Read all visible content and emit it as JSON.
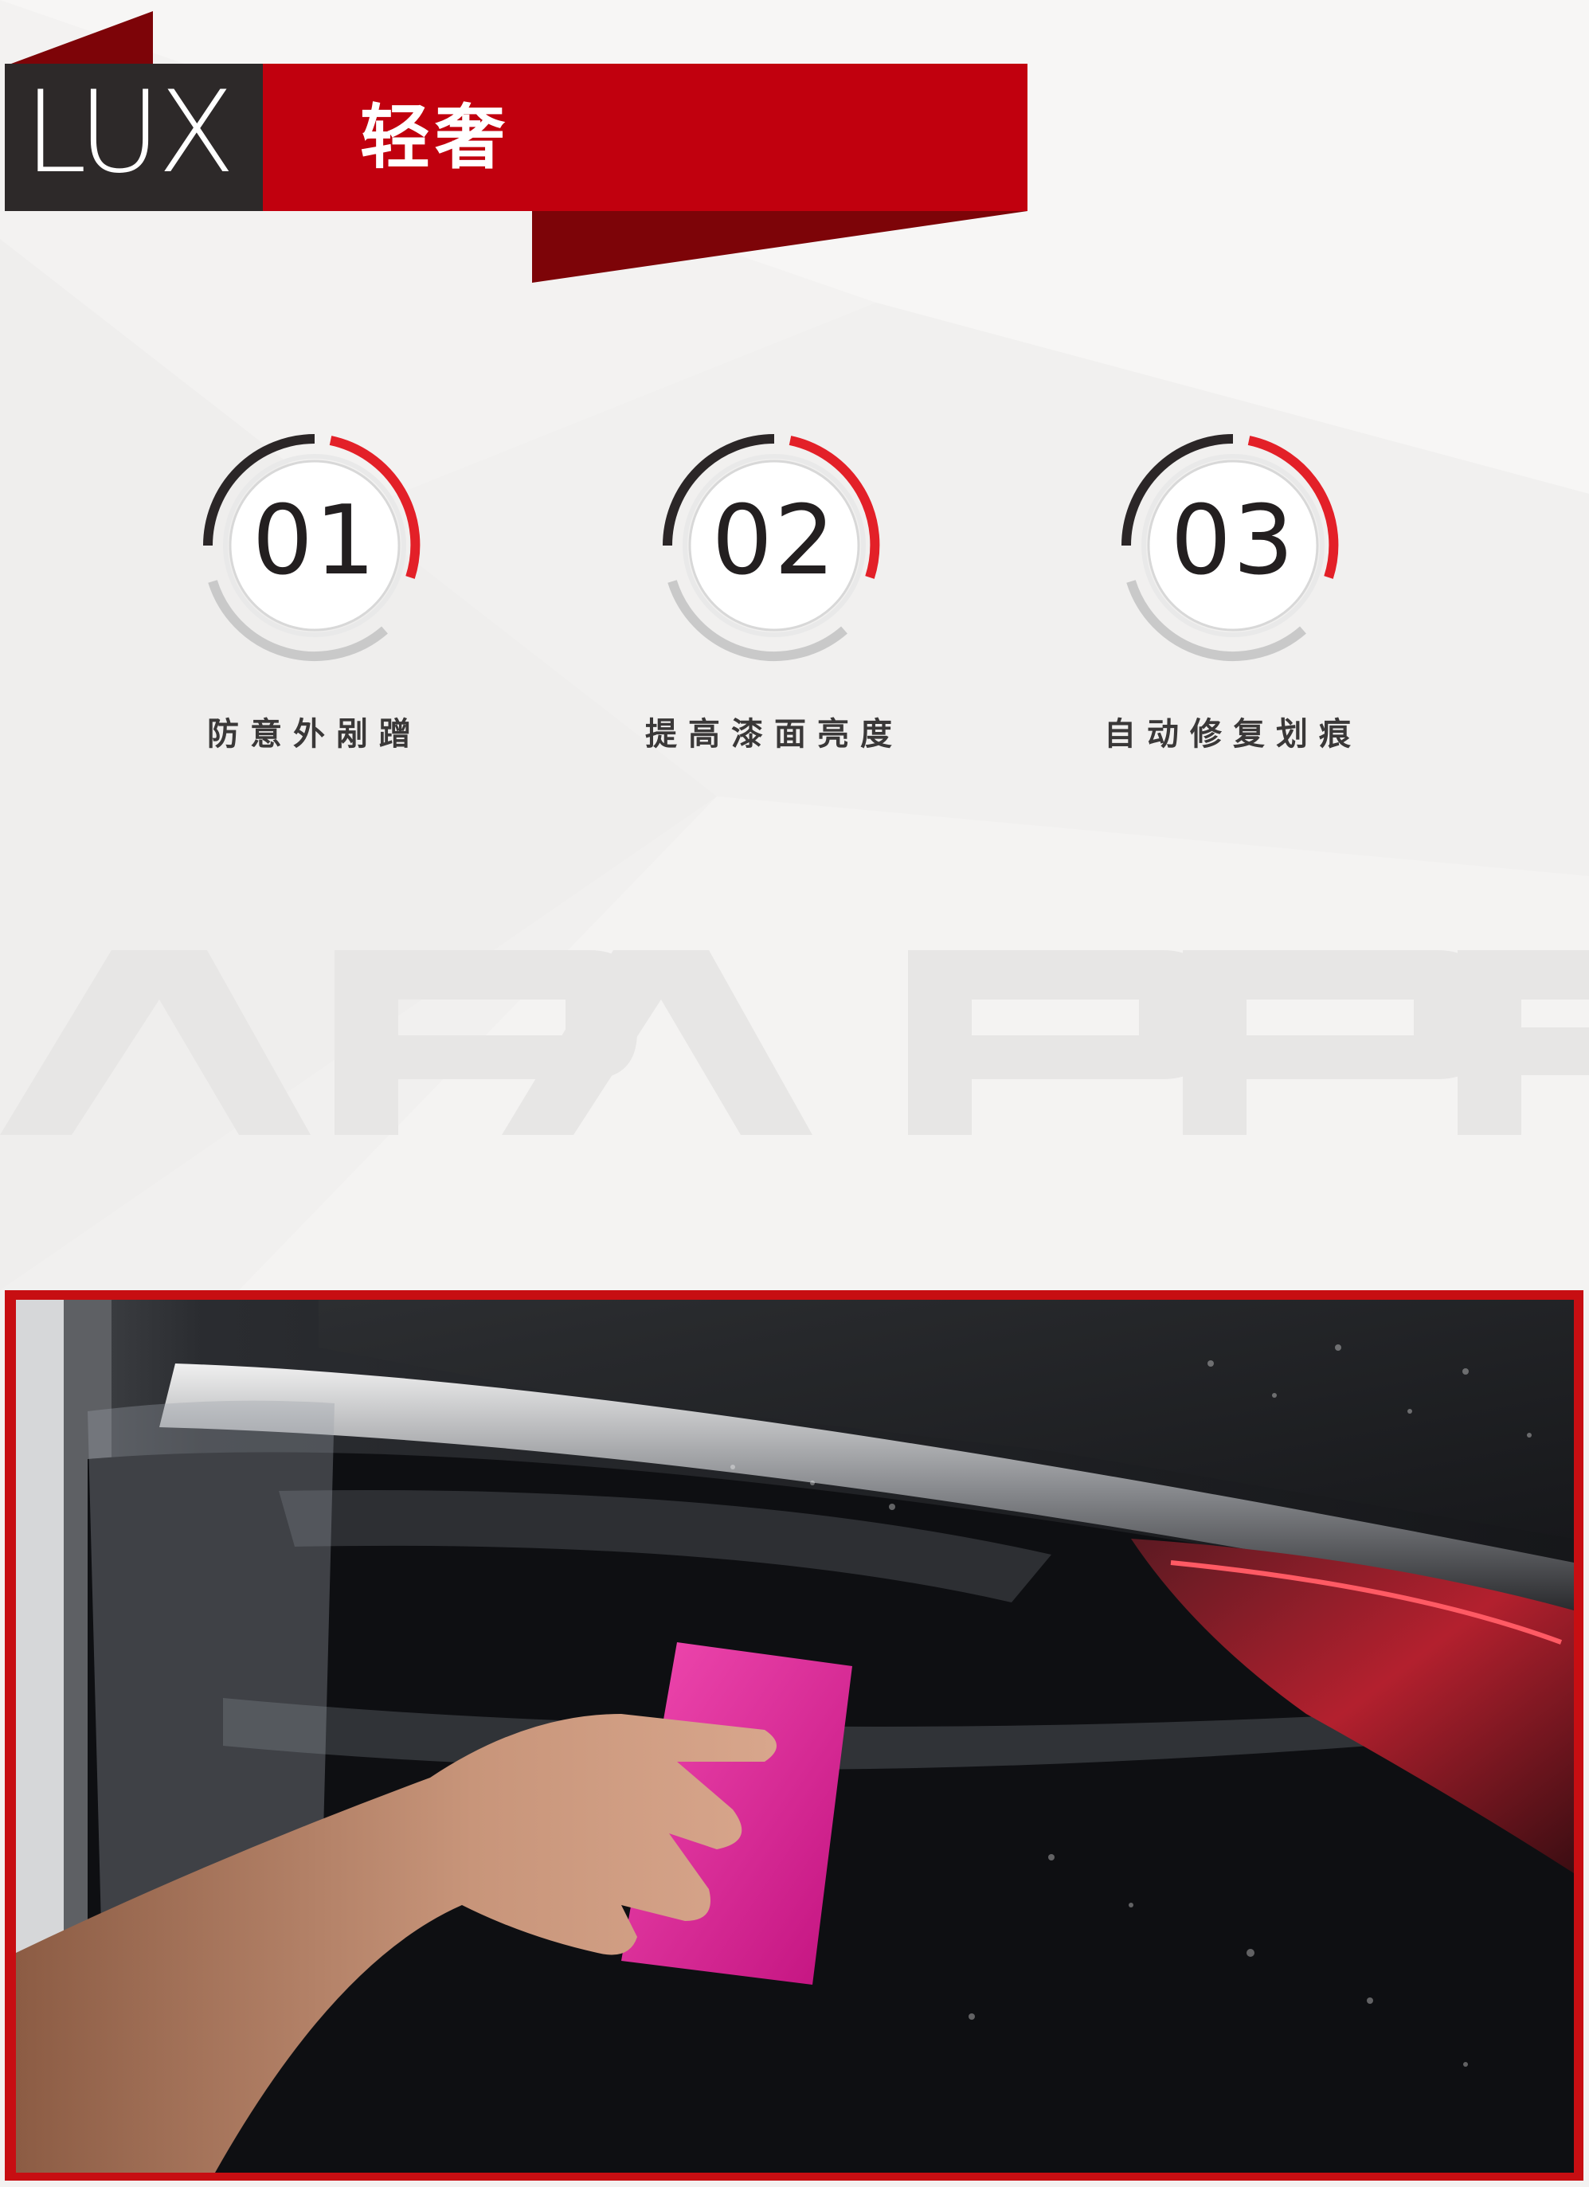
{
  "header": {
    "tag": "LUX",
    "title": "轻奢"
  },
  "features": [
    {
      "number": "01",
      "label": "防意外剐蹭"
    },
    {
      "number": "02",
      "label": "提高漆面亮度"
    },
    {
      "number": "03",
      "label": "自动修复划痕"
    }
  ],
  "watermark": "APA PPF",
  "colors": {
    "accent_red": "#c1000e",
    "dark_red": "#7d0408",
    "ring_red": "#e32028",
    "dark_tag": "#2d2929",
    "ring_dark": "#2b2627",
    "ring_gray": "#c9c9c9",
    "background": "#f3f2f1"
  },
  "photo": {
    "subject": "car-taillight-film-install",
    "tool_icon": "pink-squeegee-icon"
  }
}
